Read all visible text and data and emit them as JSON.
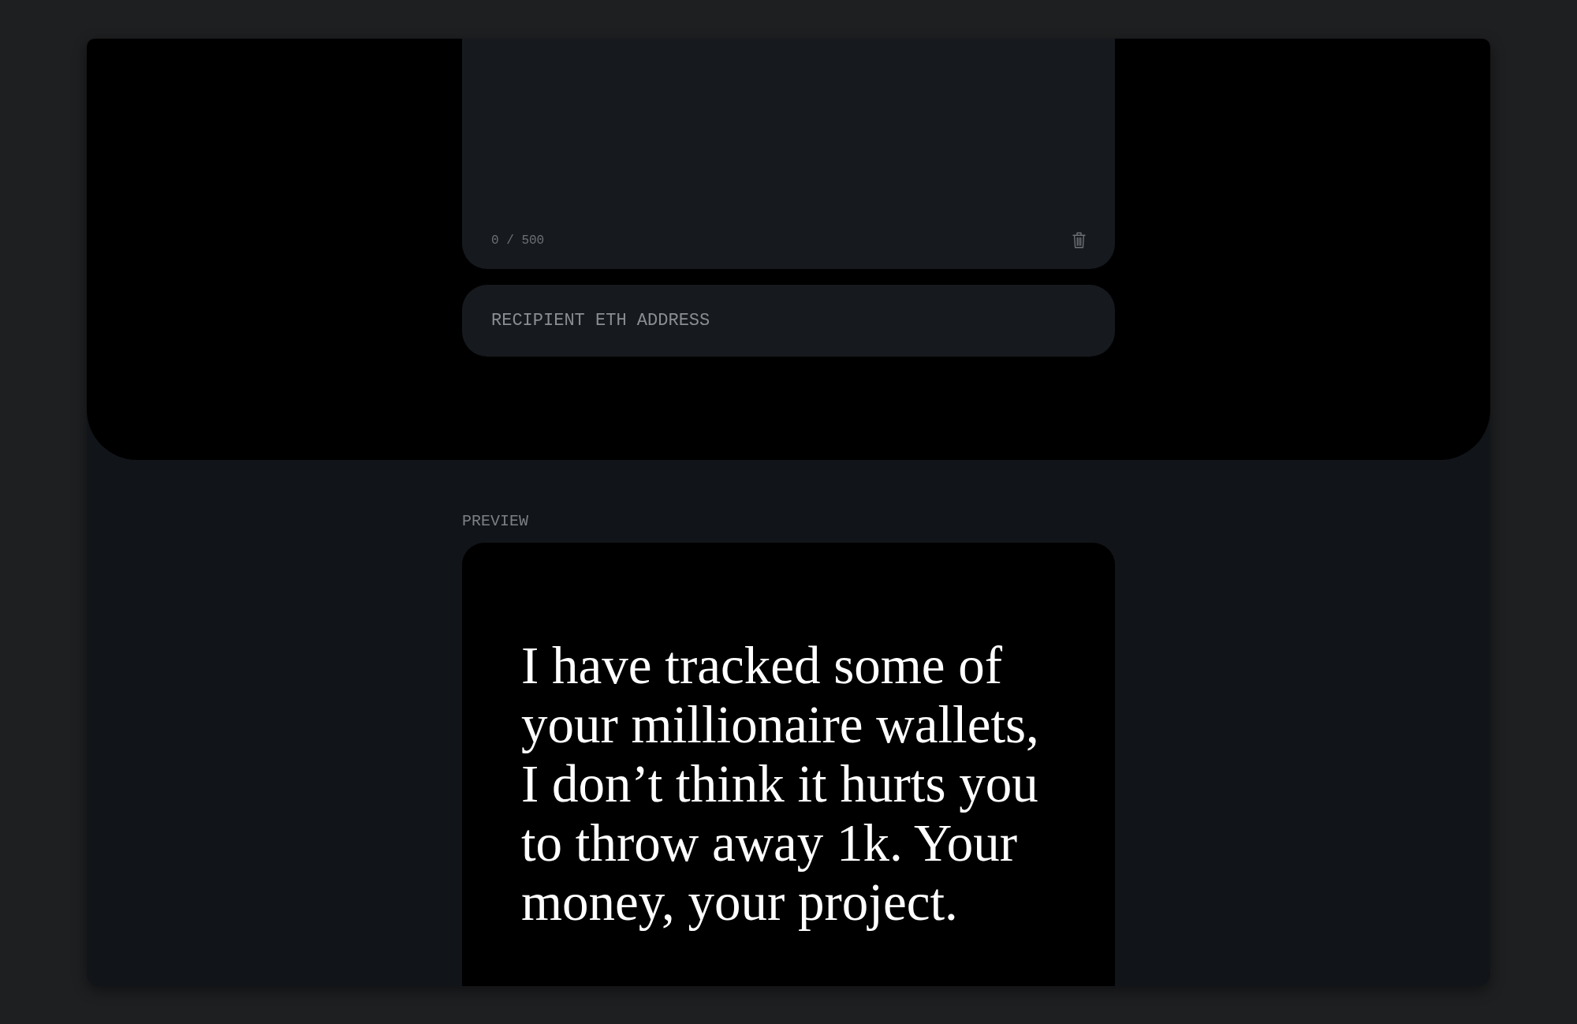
{
  "message_field": {
    "counter": "0 / 500"
  },
  "address_field": {
    "placeholder": "RECIPIENT ETH ADDRESS"
  },
  "preview": {
    "label": "PREVIEW",
    "text": "I have tracked some of your millionaire wallets, I don’t think it hurts you to throw away 1k. Your money, your project."
  }
}
